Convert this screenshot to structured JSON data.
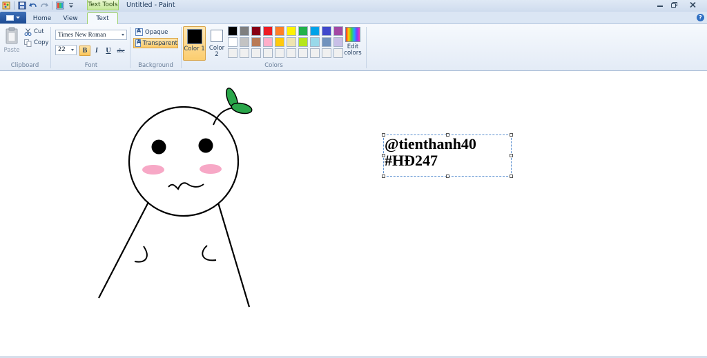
{
  "window": {
    "title": "Untitled - Paint",
    "context_tab": "Text Tools"
  },
  "tabs": {
    "home": "Home",
    "view": "View",
    "text": "Text"
  },
  "help_glyph": "?",
  "clipboard": {
    "paste": "Paste",
    "cut": "Cut",
    "copy": "Copy",
    "group": "Clipboard"
  },
  "font": {
    "family": "Times New Roman",
    "size": "22",
    "group": "Font",
    "bold": "B",
    "italic": "I",
    "underline": "U",
    "strike": "abc"
  },
  "background": {
    "opaque": "Opaque",
    "transparent": "Transparent",
    "group": "Background"
  },
  "colors": {
    "color1": "Color 1",
    "color2": "Color 2",
    "edit": "Edit colors",
    "group": "Colors",
    "palette": [
      "#000000",
      "#7f7f7f",
      "#880015",
      "#ed1c24",
      "#ff7f27",
      "#fff200",
      "#22b14c",
      "#00a2e8",
      "#3f48cc",
      "#a349a4",
      "#ffffff",
      "#c3c3c3",
      "#b97a57",
      "#ffaec9",
      "#ffc90e",
      "#efe4b0",
      "#b5e61d",
      "#99d9ea",
      "#7092be",
      "#c8bfe7",
      "#f0f0f0",
      "#f0f0f0",
      "#f0f0f0",
      "#f0f0f0",
      "#f0f0f0",
      "#f0f0f0",
      "#f0f0f0",
      "#f0f0f0",
      "#f0f0f0",
      "#f0f0f0"
    ]
  },
  "canvas": {
    "text_line1": "@tienthanh40",
    "text_line2": "#HĐ247"
  }
}
